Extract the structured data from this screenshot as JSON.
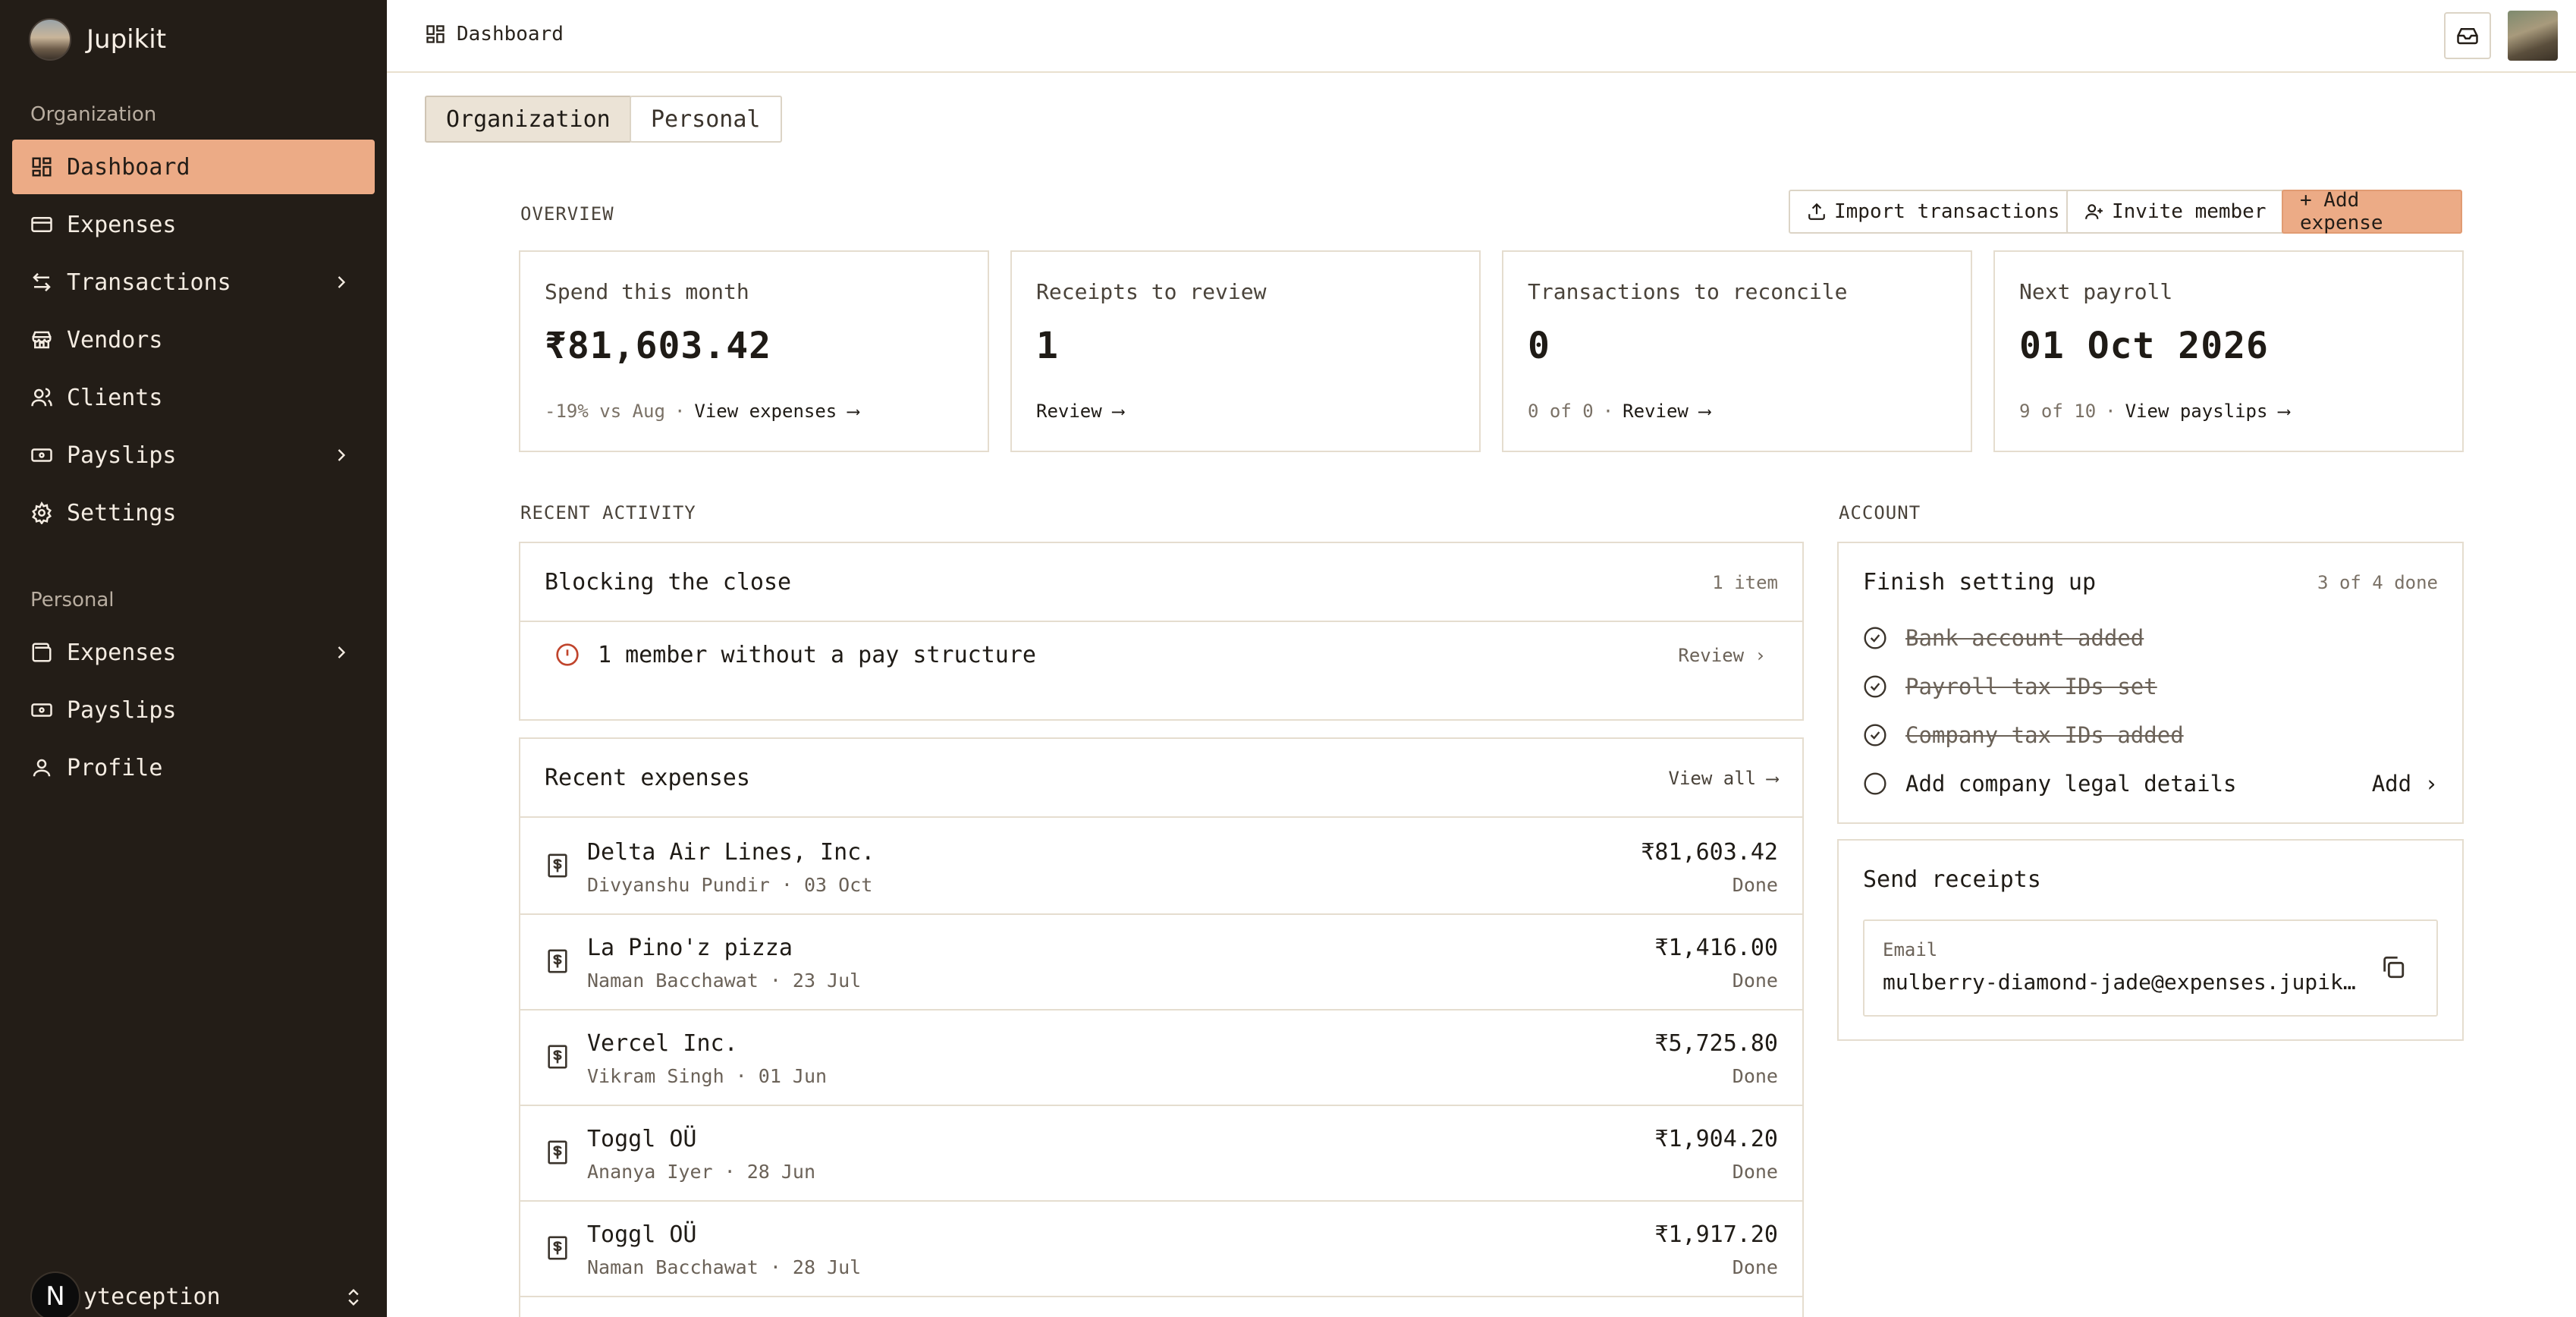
{
  "app": {
    "name": "Jupikit"
  },
  "sidebar": {
    "org_section": "Organization",
    "org_items": [
      {
        "label": "Dashboard",
        "icon": "dashboard-icon",
        "active": true
      },
      {
        "label": "Expenses",
        "icon": "credit-card-icon"
      },
      {
        "label": "Transactions",
        "icon": "arrows-left-right-icon",
        "expandable": true
      },
      {
        "label": "Vendors",
        "icon": "store-icon"
      },
      {
        "label": "Clients",
        "icon": "users-icon"
      },
      {
        "label": "Payslips",
        "icon": "banknote-icon",
        "expandable": true
      },
      {
        "label": "Settings",
        "icon": "gear-icon"
      }
    ],
    "personal_section": "Personal",
    "personal_items": [
      {
        "label": "Expenses",
        "icon": "wallet-icon",
        "expandable": true
      },
      {
        "label": "Payslips",
        "icon": "banknote-icon"
      },
      {
        "label": "Profile",
        "icon": "user-icon"
      }
    ],
    "footer": {
      "avatar_letter": "N",
      "org_name": "yteception"
    }
  },
  "topbar": {
    "breadcrumb": "Dashboard"
  },
  "tabs": [
    {
      "label": "Organization",
      "active": true
    },
    {
      "label": "Personal",
      "active": false
    }
  ],
  "overview": {
    "label": "OVERVIEW",
    "actions": {
      "import": "Import transactions",
      "invite": "Invite member",
      "add": "+ Add expense"
    },
    "stats": [
      {
        "title": "Spend this month",
        "value": "₹81,603.42",
        "meta": "-19% vs Aug",
        "link": "View expenses ⟶"
      },
      {
        "title": "Receipts to review",
        "value": "1",
        "meta": "",
        "link": "Review ⟶"
      },
      {
        "title": "Transactions to reconcile",
        "value": "0",
        "meta": "0 of 0",
        "link": "Review ⟶"
      },
      {
        "title": "Next payroll",
        "value": "01 Oct 2026",
        "meta": "9 of 10",
        "link": "View payslips ⟶"
      }
    ]
  },
  "recent_activity": {
    "label": "RECENT ACTIVITY",
    "blocking": {
      "title": "Blocking the close",
      "count": "1 item",
      "item": "1 member without a pay structure",
      "action": "Review ›"
    },
    "expenses": {
      "title": "Recent expenses",
      "view_all": "View all ⟶",
      "rows": [
        {
          "name": "Delta Air Lines, Inc.",
          "sub": "Divyanshu Pundir · 03 Oct",
          "amount": "₹81,603.42",
          "status": "Done"
        },
        {
          "name": "La Pino'z pizza",
          "sub": "Naman Bacchawat · 23 Jul",
          "amount": "₹1,416.00",
          "status": "Done"
        },
        {
          "name": "Vercel Inc.",
          "sub": "Vikram Singh · 01 Jun",
          "amount": "₹5,725.80",
          "status": "Done"
        },
        {
          "name": "Toggl OÜ",
          "sub": "Ananya Iyer · 28 Jun",
          "amount": "₹1,904.20",
          "status": "Done"
        },
        {
          "name": "Toggl OÜ",
          "sub": "Naman Bacchawat · 28 Jul",
          "amount": "₹1,917.20",
          "status": "Done"
        }
      ]
    }
  },
  "account": {
    "label": "ACCOUNT",
    "setup": {
      "title": "Finish setting up",
      "progress": "3 of 4 done",
      "items": [
        {
          "label": "Bank account added",
          "done": true
        },
        {
          "label": "Payroll tax IDs set",
          "done": true
        },
        {
          "label": "Company tax IDs added",
          "done": true
        },
        {
          "label": "Add company legal details",
          "done": false,
          "action": "Add ›"
        }
      ]
    },
    "receipts": {
      "title": "Send receipts",
      "email_label": "Email",
      "email_value": "mulberry-diamond-jade@expenses.jupikit.com"
    }
  }
}
